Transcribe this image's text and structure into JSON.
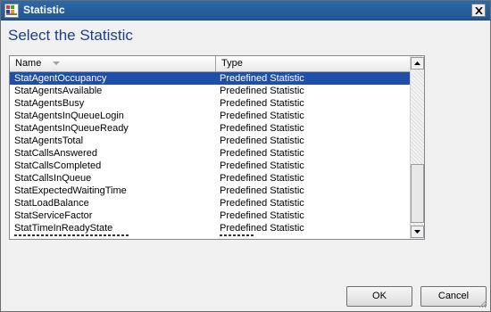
{
  "window": {
    "title": "Statistic"
  },
  "heading": "Select the Statistic",
  "table": {
    "columns": [
      "Name",
      "Type"
    ],
    "rows": [
      {
        "name": "StatAgentOccupancy",
        "type": "Predefined Statistic",
        "selected": true
      },
      {
        "name": "StatAgentsAvailable",
        "type": "Predefined Statistic"
      },
      {
        "name": "StatAgentsBusy",
        "type": "Predefined Statistic"
      },
      {
        "name": "StatAgentsInQueueLogin",
        "type": "Predefined Statistic"
      },
      {
        "name": "StatAgentsInQueueReady",
        "type": "Predefined Statistic"
      },
      {
        "name": "StatAgentsTotal",
        "type": "Predefined Statistic"
      },
      {
        "name": "StatCallsAnswered",
        "type": "Predefined Statistic"
      },
      {
        "name": "StatCallsCompleted",
        "type": "Predefined Statistic"
      },
      {
        "name": "StatCallsInQueue",
        "type": "Predefined Statistic"
      },
      {
        "name": "StatExpectedWaitingTime",
        "type": "Predefined Statistic"
      },
      {
        "name": "StatLoadBalance",
        "type": "Predefined Statistic"
      },
      {
        "name": "StatServiceFactor",
        "type": "Predefined Statistic"
      },
      {
        "name": "StatTimeInReadyState",
        "type": "Predefined Statistic"
      }
    ]
  },
  "buttons": {
    "ok": "OK",
    "cancel": "Cancel"
  },
  "colors": {
    "titlebar": "#1f5592",
    "selection": "#1f4fa8",
    "heading": "#1b3f8a"
  }
}
